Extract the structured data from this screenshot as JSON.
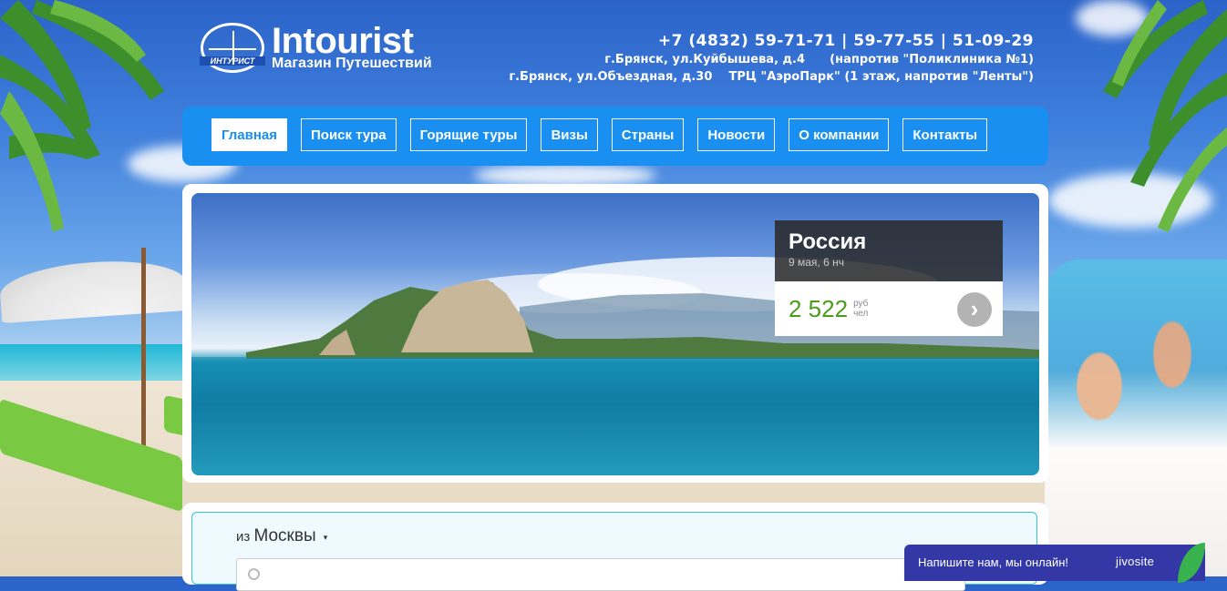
{
  "logo": {
    "globe_text": "ИНТУРИСТ",
    "brand": "Intourist",
    "tagline": "Магазин Путешествий"
  },
  "contacts": {
    "phones": "+7 (4832) 59-71-71 | 59-77-55 | 51-09-29",
    "address1": "г.Брянск, ул.Куйбышева, д.4      (напротив \"Поликлиника №1)",
    "address2": "г.Брянск, ул.Объездная, д.30    ТРЦ \"АэроПарк\" (1 этаж, напротив \"Ленты\")"
  },
  "nav": {
    "items": [
      {
        "label": "Главная",
        "active": true
      },
      {
        "label": "Поиск тура"
      },
      {
        "label": "Горящие туры"
      },
      {
        "label": "Визы"
      },
      {
        "label": "Страны"
      },
      {
        "label": "Новости"
      },
      {
        "label": "О компании"
      },
      {
        "label": "Контакты"
      }
    ]
  },
  "slider": {
    "card": {
      "title": "Россия",
      "date": "9 мая, 6 нч",
      "price": "2 522",
      "unit_currency": "руб",
      "unit_per": "чел",
      "arrow_icon": "chevron-right-icon"
    }
  },
  "search": {
    "from_prefix": "из",
    "from_city": "Москвы",
    "caret": "▾"
  },
  "chat": {
    "message": "Напишите нам, мы онлайн!",
    "brand": "jivosite"
  },
  "colors": {
    "nav_bg": "#1a8ff2",
    "price_green": "#4a9c1a",
    "chat_bg": "#3338a6"
  }
}
